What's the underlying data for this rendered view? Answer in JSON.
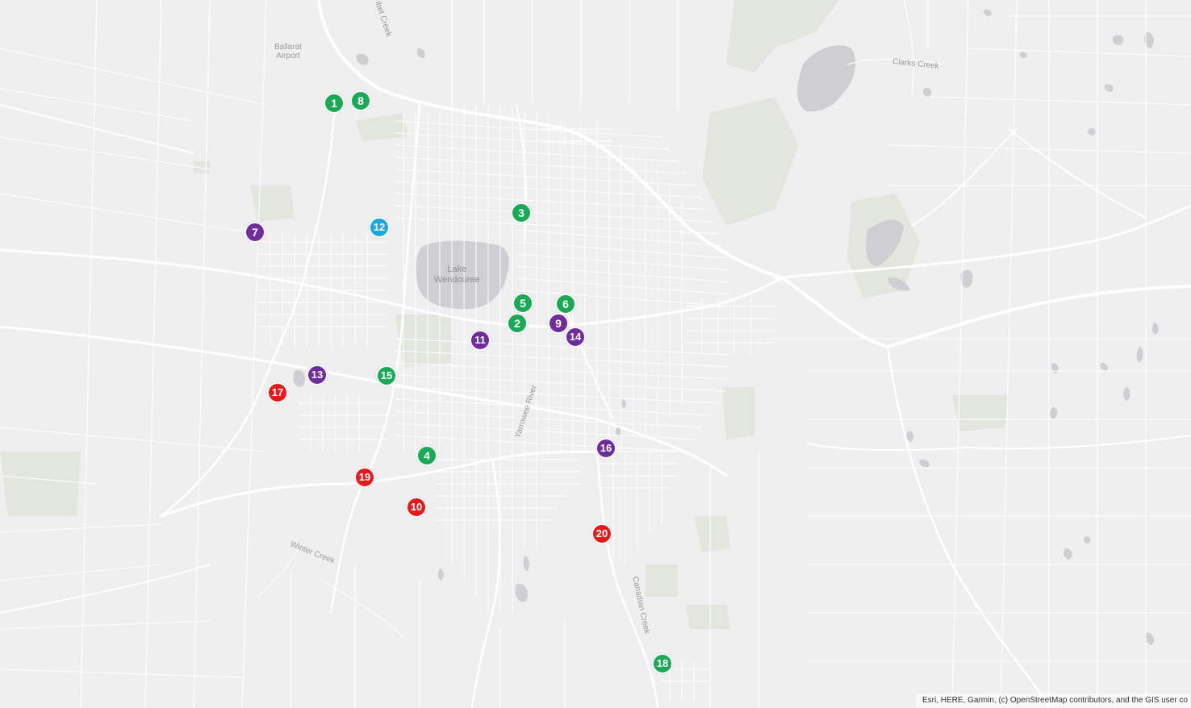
{
  "colors": {
    "background": "#efefef",
    "water": "#cfcfd3",
    "park": "#e2e6df",
    "major_road": "#ffffff",
    "minor_road": "#ffffff",
    "category_a": "#1aaa55",
    "category_b": "#6f2c9d",
    "category_c": "#1ba8e0",
    "category_d": "#e31b1b"
  },
  "labels": {
    "airport": [
      "Ballarat",
      "Airport"
    ],
    "lake": [
      "Lake",
      "Wendouree"
    ],
    "clarks_creek": "Clarks Creek",
    "winter_creek": "Winter Creek",
    "yarrowee_river": "Yarrowee River",
    "canadian_creek": "Canadian Creek",
    "top_creek": "ibet Creek"
  },
  "markers": [
    {
      "label": "1",
      "category": "category_a"
    },
    {
      "label": "2",
      "category": "category_a"
    },
    {
      "label": "3",
      "category": "category_a"
    },
    {
      "label": "4",
      "category": "category_a"
    },
    {
      "label": "5",
      "category": "category_a"
    },
    {
      "label": "6",
      "category": "category_a"
    },
    {
      "label": "7",
      "category": "category_b"
    },
    {
      "label": "8",
      "category": "category_a"
    },
    {
      "label": "9",
      "category": "category_b"
    },
    {
      "label": "10",
      "category": "category_d"
    },
    {
      "label": "11",
      "category": "category_b"
    },
    {
      "label": "12",
      "category": "category_c"
    },
    {
      "label": "13",
      "category": "category_b"
    },
    {
      "label": "14",
      "category": "category_b"
    },
    {
      "label": "15",
      "category": "category_a"
    },
    {
      "label": "16",
      "category": "category_b"
    },
    {
      "label": "17",
      "category": "category_d"
    },
    {
      "label": "18",
      "category": "category_a"
    },
    {
      "label": "19",
      "category": "category_d"
    },
    {
      "label": "20",
      "category": "category_d"
    }
  ],
  "attribution": "Esri, HERE, Garmin, (c) OpenStreetMap contributors, and the GIS user co"
}
